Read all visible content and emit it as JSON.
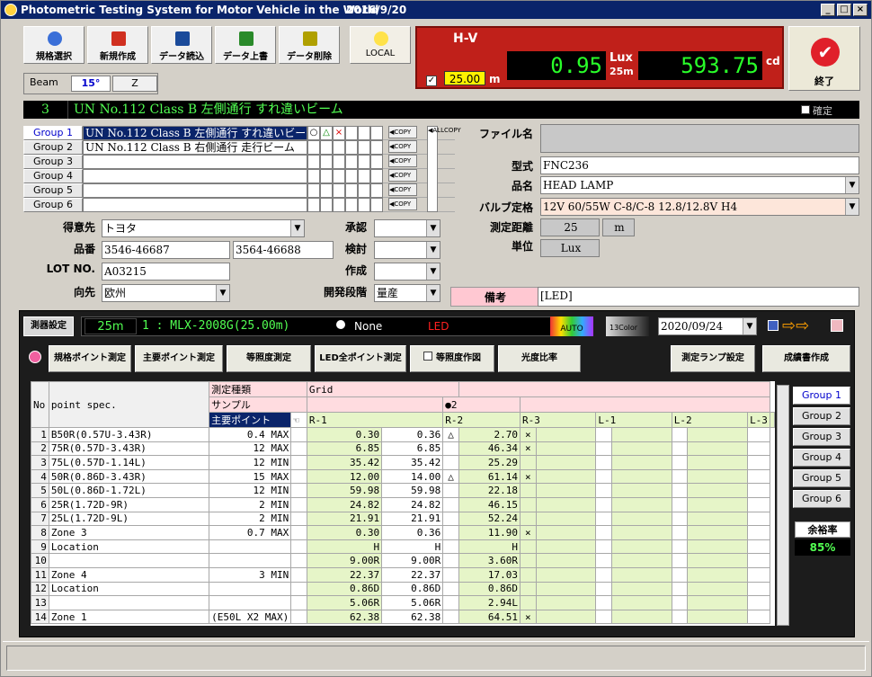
{
  "window": {
    "title": "Photometric Testing System for Motor Vehicle in the World",
    "date": "2016/9/20"
  },
  "toolbar": [
    {
      "label": "規格選択",
      "icon": "spec-select-icon",
      "color": "#3a6fd8"
    },
    {
      "label": "新規作成",
      "icon": "new-icon",
      "color": "#d03020"
    },
    {
      "label": "データ読込",
      "icon": "load-icon",
      "color": "#1a4a9a"
    },
    {
      "label": "データ上書",
      "icon": "overwrite-icon",
      "color": "#2a8a2a"
    },
    {
      "label": "データ削除",
      "icon": "delete-icon",
      "color": "#b0a000"
    },
    {
      "label": "LOCAL",
      "icon": "local-lamp-icon",
      "color": "#ffe24a"
    }
  ],
  "readout": {
    "hv": "H-V",
    "distance": "25.00",
    "distance_unit": "m",
    "lux_value": "0.95",
    "lux_unit": "Lux",
    "lux_dist": "25m",
    "cd_value": "593.75",
    "cd_unit": "cd"
  },
  "exit_label": "終了",
  "beam": {
    "label": "Beam",
    "angle": "15°",
    "mode": "Z"
  },
  "spec": {
    "num": "3",
    "title": "UN No.112 Class B 左側通行 すれ違いビーム",
    "confirm": "確定"
  },
  "groups": [
    {
      "btn": "Group 1",
      "name": "UN No.112 Class B 左側通行 すれ違いビーム",
      "marks": [
        "○",
        "△",
        "×",
        "",
        "",
        ""
      ]
    },
    {
      "btn": "Group 2",
      "name": "UN No.112 Class B 右側通行 走行ビーム",
      "marks": [
        "",
        "",
        "",
        "",
        "",
        ""
      ]
    },
    {
      "btn": "Group 3",
      "name": "",
      "marks": [
        "",
        "",
        "",
        "",
        "",
        ""
      ]
    },
    {
      "btn": "Group 4",
      "name": "",
      "marks": [
        "",
        "",
        "",
        "",
        "",
        ""
      ]
    },
    {
      "btn": "Group 5",
      "name": "",
      "marks": [
        "",
        "",
        "",
        "",
        "",
        ""
      ]
    },
    {
      "btn": "Group 6",
      "name": "",
      "marks": [
        "",
        "",
        "",
        "",
        "",
        ""
      ]
    }
  ],
  "copy_label": "◀COPY",
  "allcopy_label": "◀ALLCOPY",
  "form": {
    "customer_label": "得意先",
    "customer": "トヨタ",
    "part_label": "品番",
    "part1": "3546-46687",
    "part2": "3564-46688",
    "lot_label": "LOT NO.",
    "lot": "A03215",
    "dest_label": "向先",
    "dest": "欧州",
    "approve_label": "承認",
    "review_label": "検討",
    "create_label": "作成",
    "stage_label": "開発段階",
    "stage": "量産"
  },
  "file": {
    "file_label": "ファイル名",
    "file": "",
    "model_label": "型式",
    "model": "FNC236",
    "name_label": "品名",
    "name": "HEAD LAMP",
    "bulb_label": "バルブ定格",
    "bulb": "12V 60/55W  C-8/C-8  12.8/12.8V H4",
    "dist_label": "測定距離",
    "dist": "25",
    "dist_unit": "m",
    "unit_label": "単位",
    "unit": "Lux",
    "notes_label": "備考",
    "notes": "[LED]"
  },
  "meas": {
    "settings": "測器設定",
    "dist": "25m",
    "device": "1 : MLX-2008G(25.00m)",
    "none": "None",
    "led": "LED",
    "auto": "AUTO",
    "color13": "13Color",
    "date": "2020/09/24",
    "buttons": [
      "規格ポイント測定",
      "主要ポイント測定",
      "等照度測定",
      "LED全ポイント測定",
      "等照度作図",
      "光度比率",
      "測定ランプ設定",
      "成績書作成"
    ]
  },
  "table": {
    "head1": [
      "No",
      "point spec.",
      "測定種類",
      "Grid"
    ],
    "sample_label": "サンプル",
    "sample_val": "●2",
    "main_label": "主要ポイント",
    "cols": [
      "R-1",
      "R-2",
      "R-3",
      "L-1",
      "L-2",
      "L-3"
    ],
    "rows": [
      [
        "1",
        "B50R(0.57U-3.43R)",
        "0.4 MAX",
        "0.30",
        "0.36",
        "△",
        "2.70",
        "×"
      ],
      [
        "2",
        "75R(0.57D-3.43R)",
        "12 MAX",
        "6.85",
        "6.85",
        "",
        "46.34",
        "×"
      ],
      [
        "3",
        "75L(0.57D-1.14L)",
        "12 MIN",
        "35.42",
        "35.42",
        "",
        "25.29",
        ""
      ],
      [
        "4",
        "50R(0.86D-3.43R)",
        "15 MAX",
        "12.00",
        "14.00",
        "△",
        "61.14",
        "×"
      ],
      [
        "5",
        "50L(0.86D-1.72L)",
        "12 MIN",
        "59.98",
        "59.98",
        "",
        "22.18",
        ""
      ],
      [
        "6",
        "25R(1.72D-9R)",
        "2 MIN",
        "24.82",
        "24.82",
        "",
        "46.15",
        ""
      ],
      [
        "7",
        "25L(1.72D-9L)",
        "2 MIN",
        "21.91",
        "21.91",
        "",
        "52.24",
        ""
      ],
      [
        "8",
        "Zone 3",
        "0.7 MAX",
        "0.30",
        "0.36",
        "",
        "11.90",
        "×"
      ],
      [
        "9",
        "Location",
        "",
        "H",
        "H",
        "",
        "H",
        ""
      ],
      [
        "10",
        "",
        "",
        "9.00R",
        "9.00R",
        "",
        "3.60R",
        ""
      ],
      [
        "11",
        "Zone 4",
        "3 MIN",
        "22.37",
        "22.37",
        "",
        "17.03",
        ""
      ],
      [
        "12",
        "Location",
        "",
        "0.86D",
        "0.86D",
        "",
        "0.86D",
        ""
      ],
      [
        "13",
        "",
        "",
        "5.06R",
        "5.06R",
        "",
        "2.94L",
        ""
      ],
      [
        "14",
        "Zone 1",
        "(E50L X2 MAX)",
        "62.38",
        "62.38",
        "",
        "64.51",
        "×"
      ]
    ]
  },
  "side_groups": [
    "Group 1",
    "Group 2",
    "Group 3",
    "Group 4",
    "Group 5",
    "Group 6"
  ],
  "margin": {
    "label": "余裕率",
    "value": "85%"
  }
}
